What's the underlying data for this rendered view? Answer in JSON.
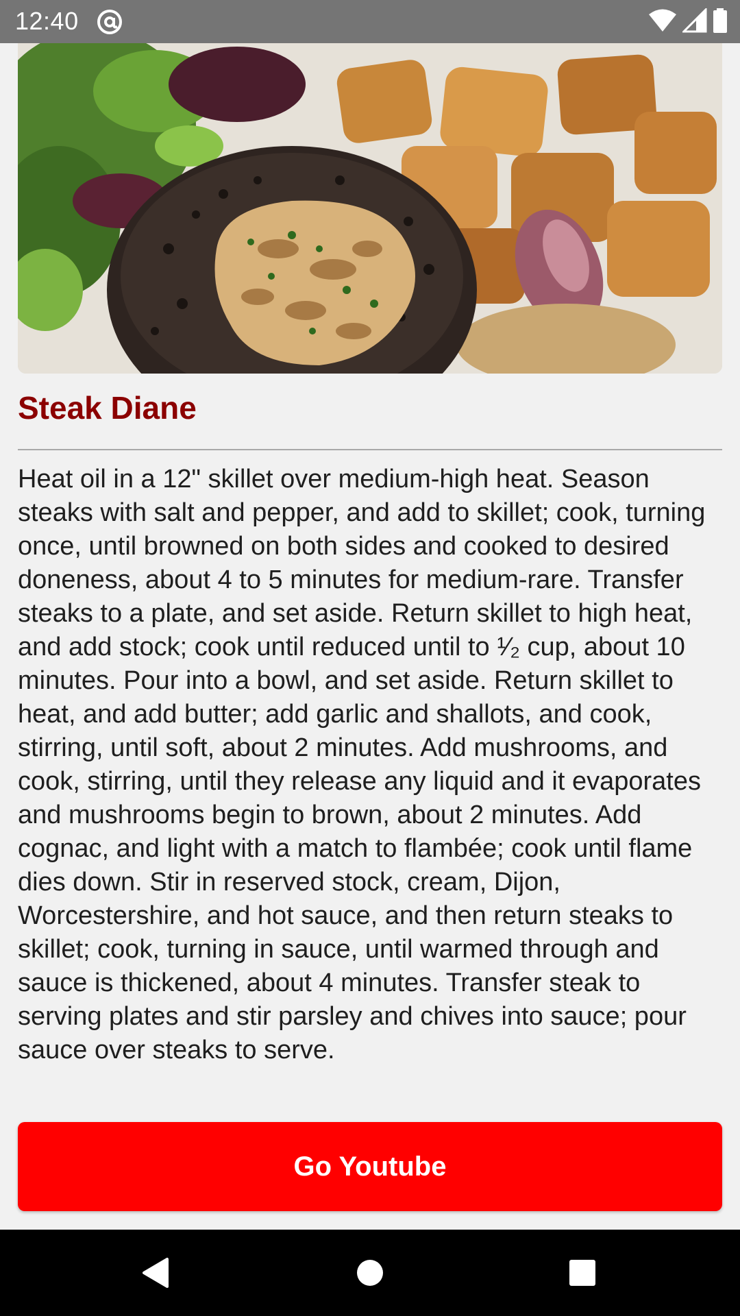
{
  "status_bar": {
    "time": "12:40",
    "icons": [
      "at-sign-icon",
      "wifi-icon",
      "cell-signal-icon",
      "battery-icon"
    ]
  },
  "recipe": {
    "title": "Steak Diane",
    "instructions": "Heat oil in a 12\" skillet over medium-high heat. Season steaks with salt and pepper, and add to skillet; cook, turning once, until browned on both sides and cooked to desired doneness, about 4 to 5 minutes for medium-rare. Transfer steaks to a plate, and set aside. Return skillet to high heat, and add stock; cook until reduced until to ¹⁄₂ cup, about 10 minutes. Pour into a bowl, and set aside. Return skillet to heat, and add butter; add garlic and shallots, and cook, stirring, until soft, about 2 minutes. Add mushrooms, and cook, stirring, until they release any liquid and it evaporates and mushrooms begin to brown, about 2 minutes. Add cognac, and light with a match to flambée; cook until flame dies down. Stir in reserved stock, cream, Dijon, Worcestershire, and hot sauce, and then return steaks to skillet; cook, turning in sauce, until warmed through and sauce is thickened, about 4 minutes. Transfer steak to serving plates and stir parsley and chives into sauce; pour sauce over steaks to serve.",
    "button_label": "Go Youtube"
  },
  "nav_bar": {
    "buttons": [
      "back-icon",
      "home-icon",
      "recents-icon"
    ]
  },
  "colors": {
    "title": "#8b0000",
    "button": "#ff0000",
    "status_bar": "#757575",
    "background": "#f1f1f1"
  }
}
